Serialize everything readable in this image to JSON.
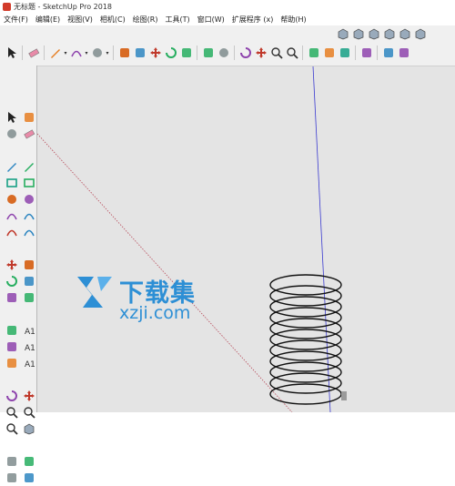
{
  "window": {
    "title": "无标题 - SketchUp Pro 2018"
  },
  "menu": [
    "文件(F)",
    "编辑(E)",
    "视图(V)",
    "相机(C)",
    "绘图(R)",
    "工具(T)",
    "窗口(W)",
    "扩展程序 (x)",
    "帮助(H)"
  ],
  "toolbar": {
    "views": [
      "iso-view-icon",
      "top-view-icon",
      "front-view-icon",
      "right-view-icon",
      "back-view-icon",
      "left-view-icon"
    ],
    "main": [
      "select-icon",
      "sep",
      "eraser-icon",
      "sep",
      "pencil-icon",
      "caret",
      "arc-icon",
      "caret",
      "shape-icon",
      "caret",
      "sep",
      "push-pull-icon",
      "follow-me-icon",
      "move-icon",
      "rotate-icon",
      "offset-icon",
      "sep",
      "tape-measure-icon",
      "paint-bucket-icon",
      "sep",
      "orbit-icon",
      "pan-icon",
      "zoom-icon",
      "zoom-extents-icon",
      "sep",
      "warehouse-icon",
      "component-icon",
      "extension-icon",
      "sep",
      "ruby-icon",
      "sep",
      "section-plane-icon",
      "section-display-icon"
    ]
  },
  "left_toolbar": [
    "select-icon",
    "component-icon",
    "paint-bucket-icon",
    "eraser-icon",
    "gap",
    "line-icon",
    "freehand-icon",
    "rectangle-icon",
    "rotated-rectangle-icon",
    "circle-icon",
    "polygon-icon",
    "arc-icon",
    "two-point-arc-icon",
    "three-point-arc-icon",
    "pie-icon",
    "gap",
    "move-icon",
    "push-pull-icon",
    "rotate-icon",
    "follow-me-icon",
    "scale-icon",
    "offset-icon",
    "gap",
    "tape-measure-icon",
    "dimension-icon",
    "protractor-icon",
    "text-icon",
    "axes-icon",
    "3d-text-icon",
    "gap",
    "orbit-icon",
    "pan-icon",
    "zoom-icon",
    "zoom-window-icon",
    "zoom-extents-icon",
    "previous-view-icon",
    "gap",
    "position-camera-icon",
    "look-around-icon",
    "walk-icon",
    "section-plane-icon"
  ],
  "watermark": {
    "cn": "下载集",
    "en": "xzji.com"
  },
  "colors": {
    "red_axis": "#b84b5a",
    "blue_axis": "#3a3ad0",
    "coil": "#111111",
    "viewport_bg": "#e4e4e4",
    "watermark": "#2d8fd5"
  }
}
